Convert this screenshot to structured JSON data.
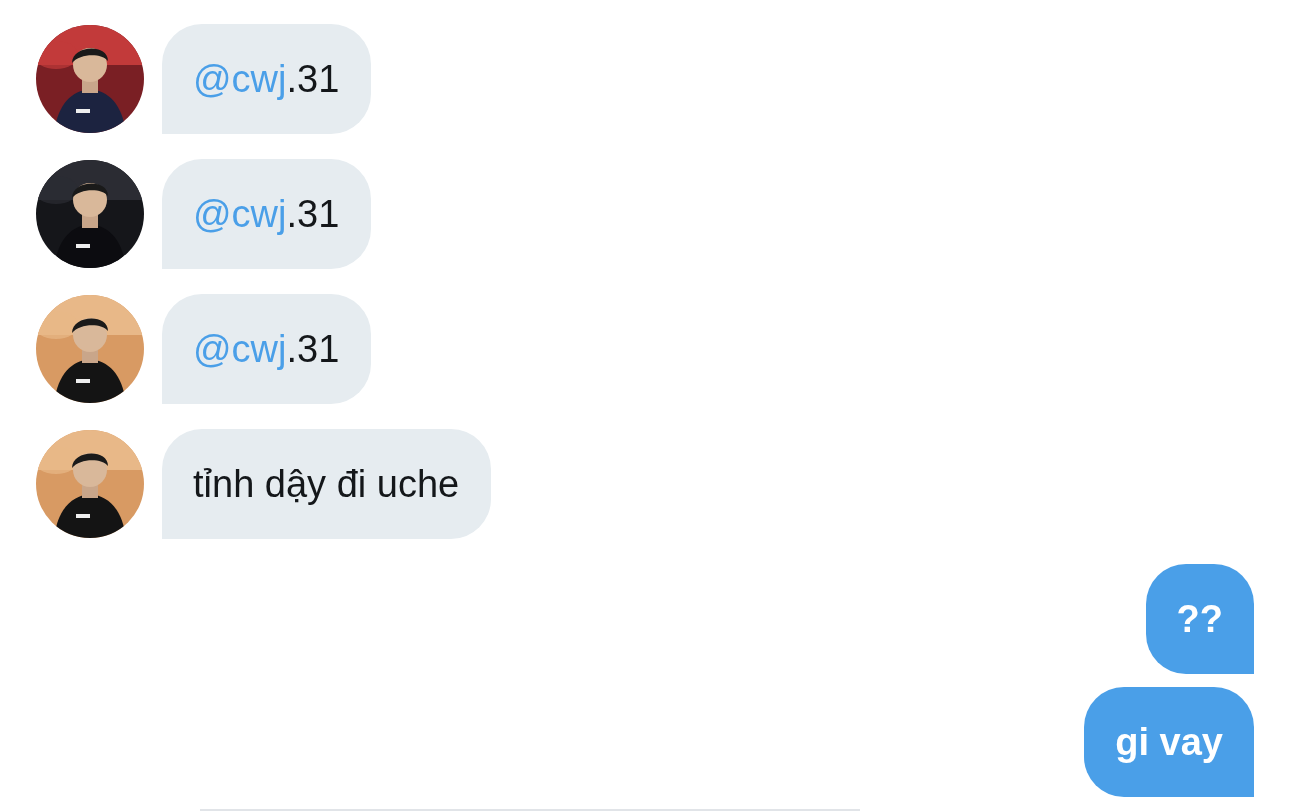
{
  "messages": [
    {
      "kind": "received",
      "mention": "@cwj",
      "text": ".31"
    },
    {
      "kind": "received",
      "mention": "@cwj",
      "text": ".31"
    },
    {
      "kind": "received",
      "mention": "@cwj",
      "text": ".31"
    },
    {
      "kind": "received",
      "text": "tỉnh dậy đi uche"
    },
    {
      "kind": "sent",
      "text": "??"
    },
    {
      "kind": "sent",
      "text": "gi vay"
    }
  ]
}
